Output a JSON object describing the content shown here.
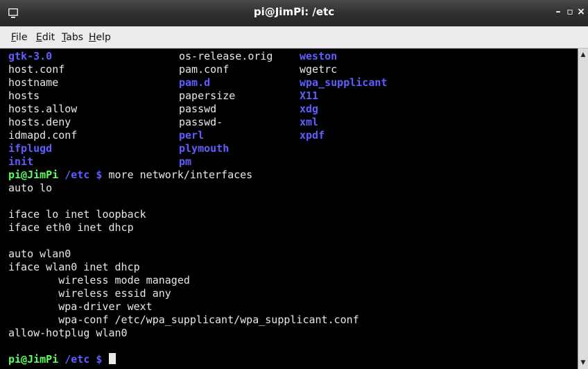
{
  "window": {
    "title": "pi@JimPi: /etc",
    "minimize": "–",
    "maximize": "▫",
    "close": "×"
  },
  "menu": {
    "file": {
      "mnemonic": "F",
      "rest": "ile"
    },
    "edit": {
      "mnemonic": "E",
      "rest": "dit"
    },
    "tabs": {
      "mnemonic": "T",
      "rest": "abs"
    },
    "help": {
      "mnemonic": "H",
      "rest": "elp"
    }
  },
  "listing": [
    [
      "gtk-3.0",
      "os-release.orig",
      "weston"
    ],
    [
      "host.conf",
      "pam.conf",
      "wgetrc"
    ],
    [
      "hostname",
      "pam.d",
      "wpa_supplicant"
    ],
    [
      "hosts",
      "papersize",
      "X11"
    ],
    [
      "hosts.allow",
      "passwd",
      "xdg"
    ],
    [
      "hosts.deny",
      "passwd-",
      "xml"
    ],
    [
      "idmapd.conf",
      "perl",
      "xpdf"
    ],
    [
      "ifplugd",
      "plymouth",
      ""
    ],
    [
      "init",
      "pm",
      ""
    ]
  ],
  "prompt": {
    "user_host": "pi@JimPi",
    "dir": "/etc $",
    "command": "more network/interfaces"
  },
  "output": [
    "auto lo",
    "",
    "iface lo inet loopback",
    "iface eth0 inet dhcp",
    "",
    "auto wlan0",
    "iface wlan0 inet dhcp",
    "        wireless mode managed",
    "        wireless essid any",
    "        wpa-driver wext",
    "        wpa-conf /etc/wpa_supplicant/wpa_supplicant.conf",
    "allow-hotplug wlan0",
    ""
  ],
  "prompt2": {
    "user_host": "pi@JimPi",
    "dir": "/etc $"
  },
  "scrollbar": {
    "up": "▲",
    "down": "▼"
  }
}
